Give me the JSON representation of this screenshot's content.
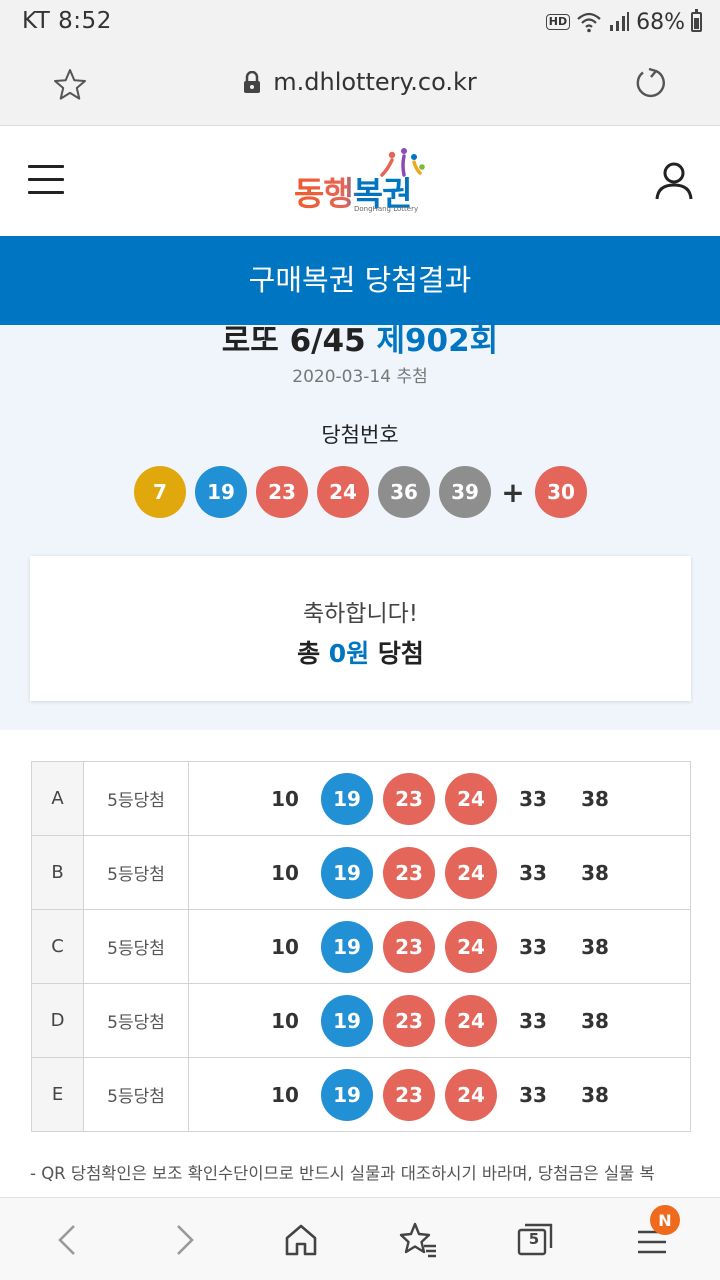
{
  "status_bar": {
    "carrier": "KT",
    "time": "8:52",
    "hd": "HD",
    "battery": "68%"
  },
  "browser": {
    "url": "m.dhlottery.co.kr",
    "tab_count": "5",
    "menu_badge": "N"
  },
  "site": {
    "logo_text": "동행복권",
    "logo_sub": "DongHang Lottery"
  },
  "page_title": "구매복권 당첨결과",
  "draw": {
    "game": "로또 6/45",
    "round": "제902회",
    "date": "2020-03-14 추첨",
    "numbers_label": "당첨번호",
    "numbers": [
      {
        "value": "7",
        "color": "#e1a80e"
      },
      {
        "value": "19",
        "color": "#2190d4"
      },
      {
        "value": "23",
        "color": "#e4665a"
      },
      {
        "value": "24",
        "color": "#e4665a"
      },
      {
        "value": "36",
        "color": "#8e8e8e"
      },
      {
        "value": "39",
        "color": "#8e8e8e"
      }
    ],
    "plus": "+",
    "bonus": {
      "value": "30",
      "color": "#e4665a"
    }
  },
  "result": {
    "congrats": "축하합니다!",
    "total_prefix": "총",
    "total_amount": "0원",
    "total_suffix": "당첨"
  },
  "tickets": [
    {
      "letter": "A",
      "rank": "5등당첨",
      "numbers": [
        "10",
        "19",
        "23",
        "24",
        "33",
        "38"
      ]
    },
    {
      "letter": "B",
      "rank": "5등당첨",
      "numbers": [
        "10",
        "19",
        "23",
        "24",
        "33",
        "38"
      ]
    },
    {
      "letter": "C",
      "rank": "5등당첨",
      "numbers": [
        "10",
        "19",
        "23",
        "24",
        "33",
        "38"
      ]
    },
    {
      "letter": "D",
      "rank": "5등당첨",
      "numbers": [
        "10",
        "19",
        "23",
        "24",
        "33",
        "38"
      ]
    },
    {
      "letter": "E",
      "rank": "5등당첨",
      "numbers": [
        "10",
        "19",
        "23",
        "24",
        "33",
        "38"
      ]
    }
  ],
  "hit_colors": {
    "19": "#2190d4",
    "23": "#e4665a",
    "24": "#e4665a"
  },
  "notice": "- QR 당첨확인은 보조 확인수단이므로 반드시 실물과 대조하시기 바라며, 당첨금은 실물 복"
}
